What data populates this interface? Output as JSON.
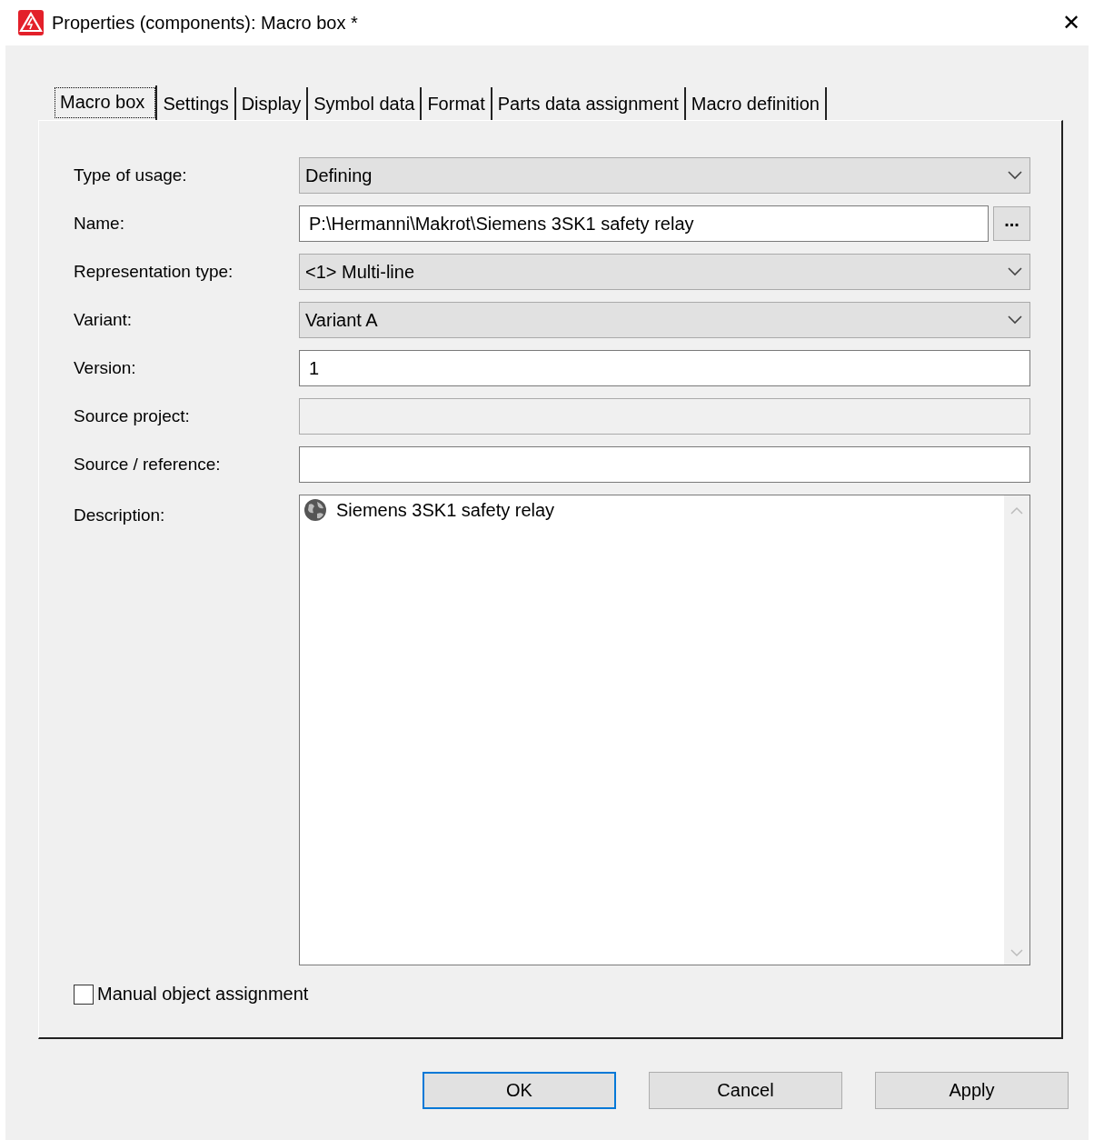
{
  "window": {
    "title": "Properties (components): Macro box *",
    "close": "✕"
  },
  "tabs": [
    {
      "label": "Macro box",
      "selected": true
    },
    {
      "label": "Settings",
      "selected": false
    },
    {
      "label": "Display",
      "selected": false
    },
    {
      "label": "Symbol data",
      "selected": false
    },
    {
      "label": "Format",
      "selected": false
    },
    {
      "label": "Parts data assignment",
      "selected": false
    },
    {
      "label": "Macro definition",
      "selected": false
    }
  ],
  "fields": [
    {
      "kind": "dropdown",
      "label": "Type of usage:",
      "value": "Defining"
    },
    {
      "kind": "browse",
      "label": "Name:",
      "value": "P:\\Hermanni\\Makrot\\Siemens 3SK1 safety relay",
      "button": "..."
    },
    {
      "kind": "dropdown",
      "label": "Representation type:",
      "value": "<1> Multi-line"
    },
    {
      "kind": "dropdown",
      "label": "Variant:",
      "value": "Variant A"
    },
    {
      "kind": "text",
      "label": "Version:",
      "value": "1",
      "disabled": false
    },
    {
      "kind": "text",
      "label": "Source project:",
      "disabled": true
    },
    {
      "kind": "text",
      "label": "Source / reference:",
      "disabled": false
    },
    {
      "kind": "multiline",
      "label": "Description:",
      "value": "Siemens 3SK1 safety relay"
    }
  ],
  "checkbox": {
    "label": "Manual object assignment",
    "checked": false
  },
  "buttons": [
    {
      "label": "OK",
      "default": true
    },
    {
      "label": "Cancel",
      "default": false
    },
    {
      "label": "Apply",
      "default": false
    }
  ]
}
